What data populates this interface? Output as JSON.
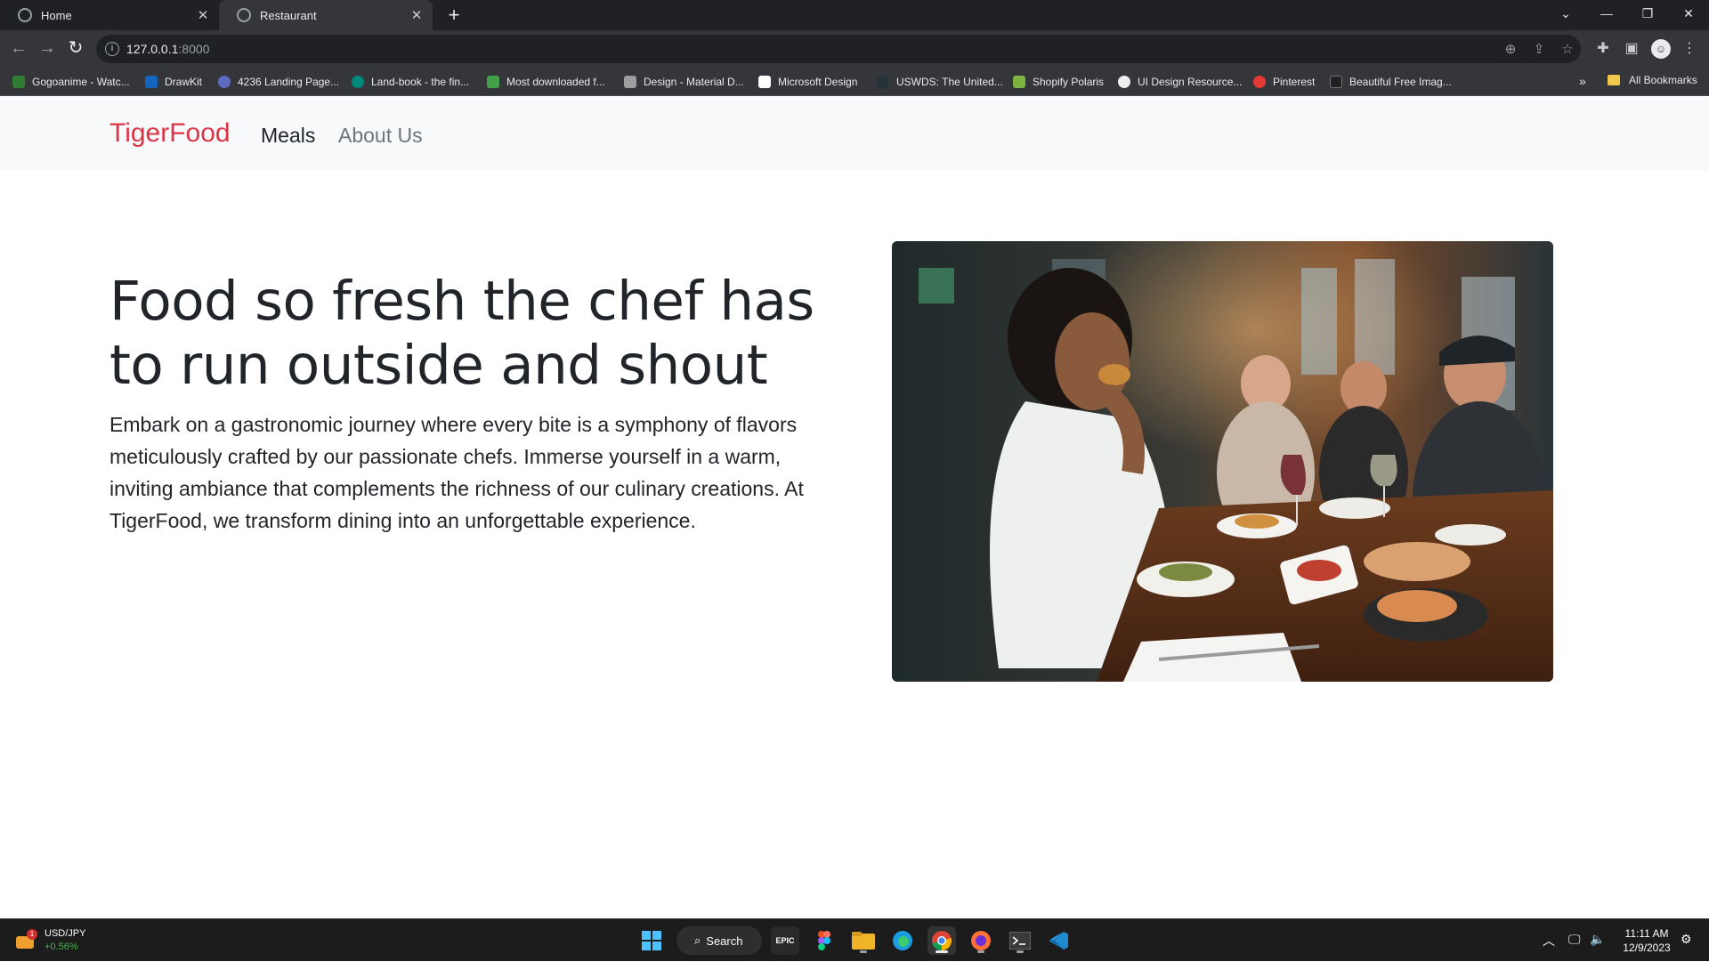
{
  "browser": {
    "tabs": [
      {
        "title": "Home"
      },
      {
        "title": "Restaurant"
      }
    ],
    "url": {
      "host": "127.0.0.1",
      "port": ":8000"
    },
    "bookmarks": [
      {
        "label": "Gogoanime - Watc...",
        "color": "#2e7d32"
      },
      {
        "label": "DrawKit",
        "color": "#1565c0"
      },
      {
        "label": "4236 Landing Page...",
        "color": "#5c6bc0"
      },
      {
        "label": "Land-book - the fin...",
        "color": "#00897b"
      },
      {
        "label": "Most downloaded f...",
        "color": "#43a047"
      },
      {
        "label": "Design - Material D...",
        "color": "#9e9e9e"
      },
      {
        "label": "Microsoft Design",
        "color": "#ffffff"
      },
      {
        "label": "USWDS: The United...",
        "color": "#263238"
      },
      {
        "label": "Shopify Polaris",
        "color": "#7cb342"
      },
      {
        "label": "UI Design Resource...",
        "color": "#eeeeee"
      },
      {
        "label": "Pinterest",
        "color": "#e53935"
      },
      {
        "label": "Beautiful Free Imag...",
        "color": "#212121"
      }
    ],
    "all_bookmarks": "All Bookmarks"
  },
  "site": {
    "brand": "TigerFood",
    "nav": [
      "Meals",
      "About Us"
    ],
    "hero_title": "Food so fresh the chef has to run outside and shout",
    "hero_text": "Embark on a gastronomic journey where every bite is a symphony of flavors meticulously crafted by our passionate chefs. Immerse yourself in a warm, inviting ambiance that complements the richness of our culinary creations. At TigerFood, we transform dining into an unforgettable experience."
  },
  "taskbar": {
    "widget": {
      "title": "USD/JPY",
      "change": "+0.56%",
      "badge": "1"
    },
    "search": "Search",
    "clock": {
      "time": "11:11 AM",
      "date": "12/9/2023"
    }
  },
  "colors": {
    "brand": "#dc3545",
    "navbar_bg": "#f8f9fa",
    "chrome_dark": "#202124",
    "chrome_mid": "#35363a"
  }
}
